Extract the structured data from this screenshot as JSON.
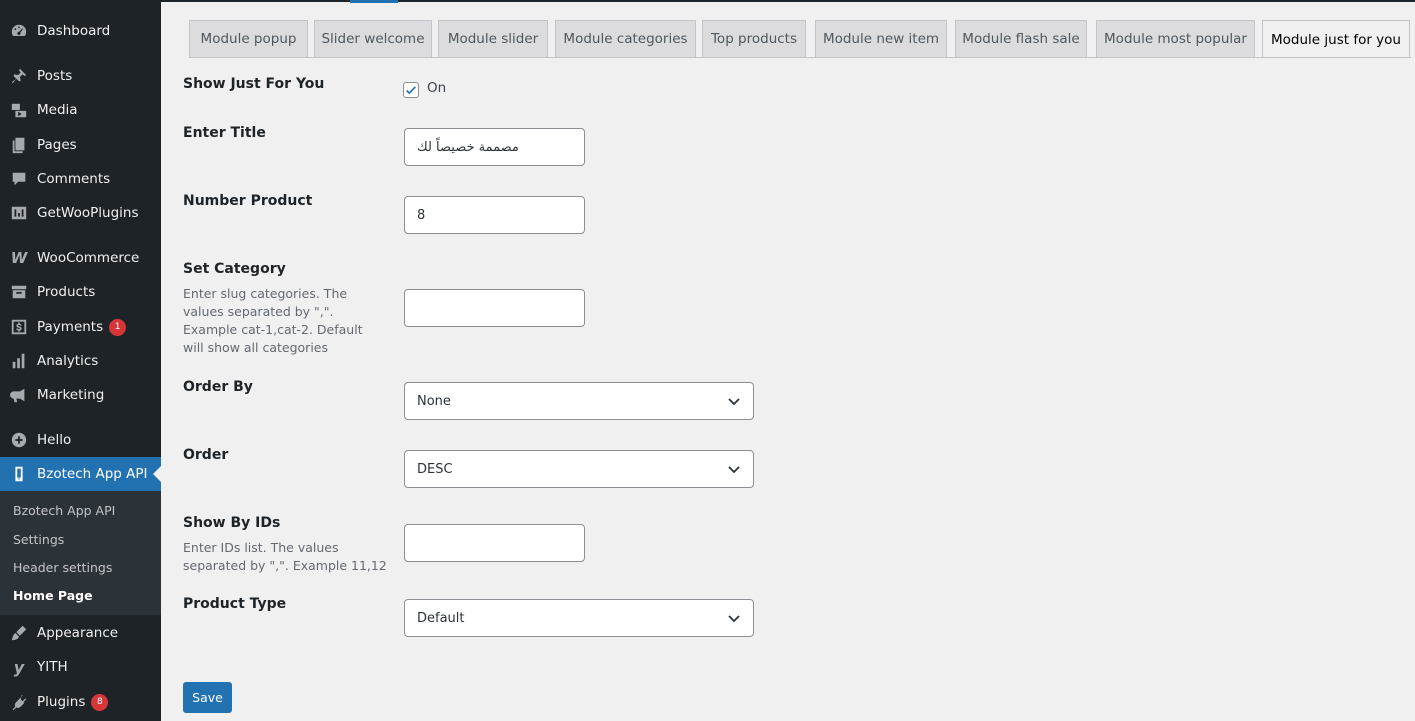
{
  "sidebar": {
    "items": [
      {
        "label": "Dashboard",
        "icon": "dashboard-icon"
      },
      {
        "label": "Posts",
        "icon": "pin-icon"
      },
      {
        "label": "Media",
        "icon": "media-icon"
      },
      {
        "label": "Pages",
        "icon": "pages-icon"
      },
      {
        "label": "Comments",
        "icon": "comment-icon"
      },
      {
        "label": "GetWooPlugins",
        "icon": "plugins-sort-icon"
      },
      {
        "label": "WooCommerce",
        "icon": "woo-icon"
      },
      {
        "label": "Products",
        "icon": "archive-icon"
      },
      {
        "label": "Payments",
        "icon": "dollar-icon",
        "badge": "1"
      },
      {
        "label": "Analytics",
        "icon": "bar-chart-icon"
      },
      {
        "label": "Marketing",
        "icon": "megaphone-icon"
      },
      {
        "label": "Hello",
        "icon": "plus-circle-icon"
      },
      {
        "label": "Bzotech App API",
        "icon": "phone-icon"
      },
      {
        "label": "Appearance",
        "icon": "brush-icon"
      },
      {
        "label": "YITH",
        "icon": "yith-icon"
      },
      {
        "label": "Plugins",
        "icon": "plug-icon",
        "badge": "8"
      }
    ],
    "submenu": [
      "Bzotech App API",
      "Settings",
      "Header settings",
      "Home Page"
    ]
  },
  "tabs": [
    "Module popup",
    "Slider welcome",
    "Module slider",
    "Module categories",
    "Top products",
    "Module new item",
    "Module flash sale",
    "Module most popular",
    "Module just for you"
  ],
  "form": {
    "show_label": "Show Just For You",
    "show_checked_label": "On",
    "title_label": "Enter Title",
    "title_value": "مصممة خصيصاً لك",
    "number_label": "Number Product",
    "number_value": "8",
    "category_label": "Set Category",
    "category_desc": "Enter slug categories. The values separated by \",\". Example cat-1,cat-2. Default will show all categories",
    "category_value": "",
    "orderby_label": "Order By",
    "orderby_value": "None",
    "order_label": "Order",
    "order_value": "DESC",
    "ids_label": "Show By IDs",
    "ids_desc": "Enter IDs list. The values separated by \",\". Example 11,12",
    "ids_value": "",
    "ptype_label": "Product Type",
    "ptype_value": "Default",
    "save_label": "Save"
  },
  "colors": {
    "sidebar_bg": "#1d2327",
    "accent": "#2271b1",
    "badge": "#d63638"
  }
}
